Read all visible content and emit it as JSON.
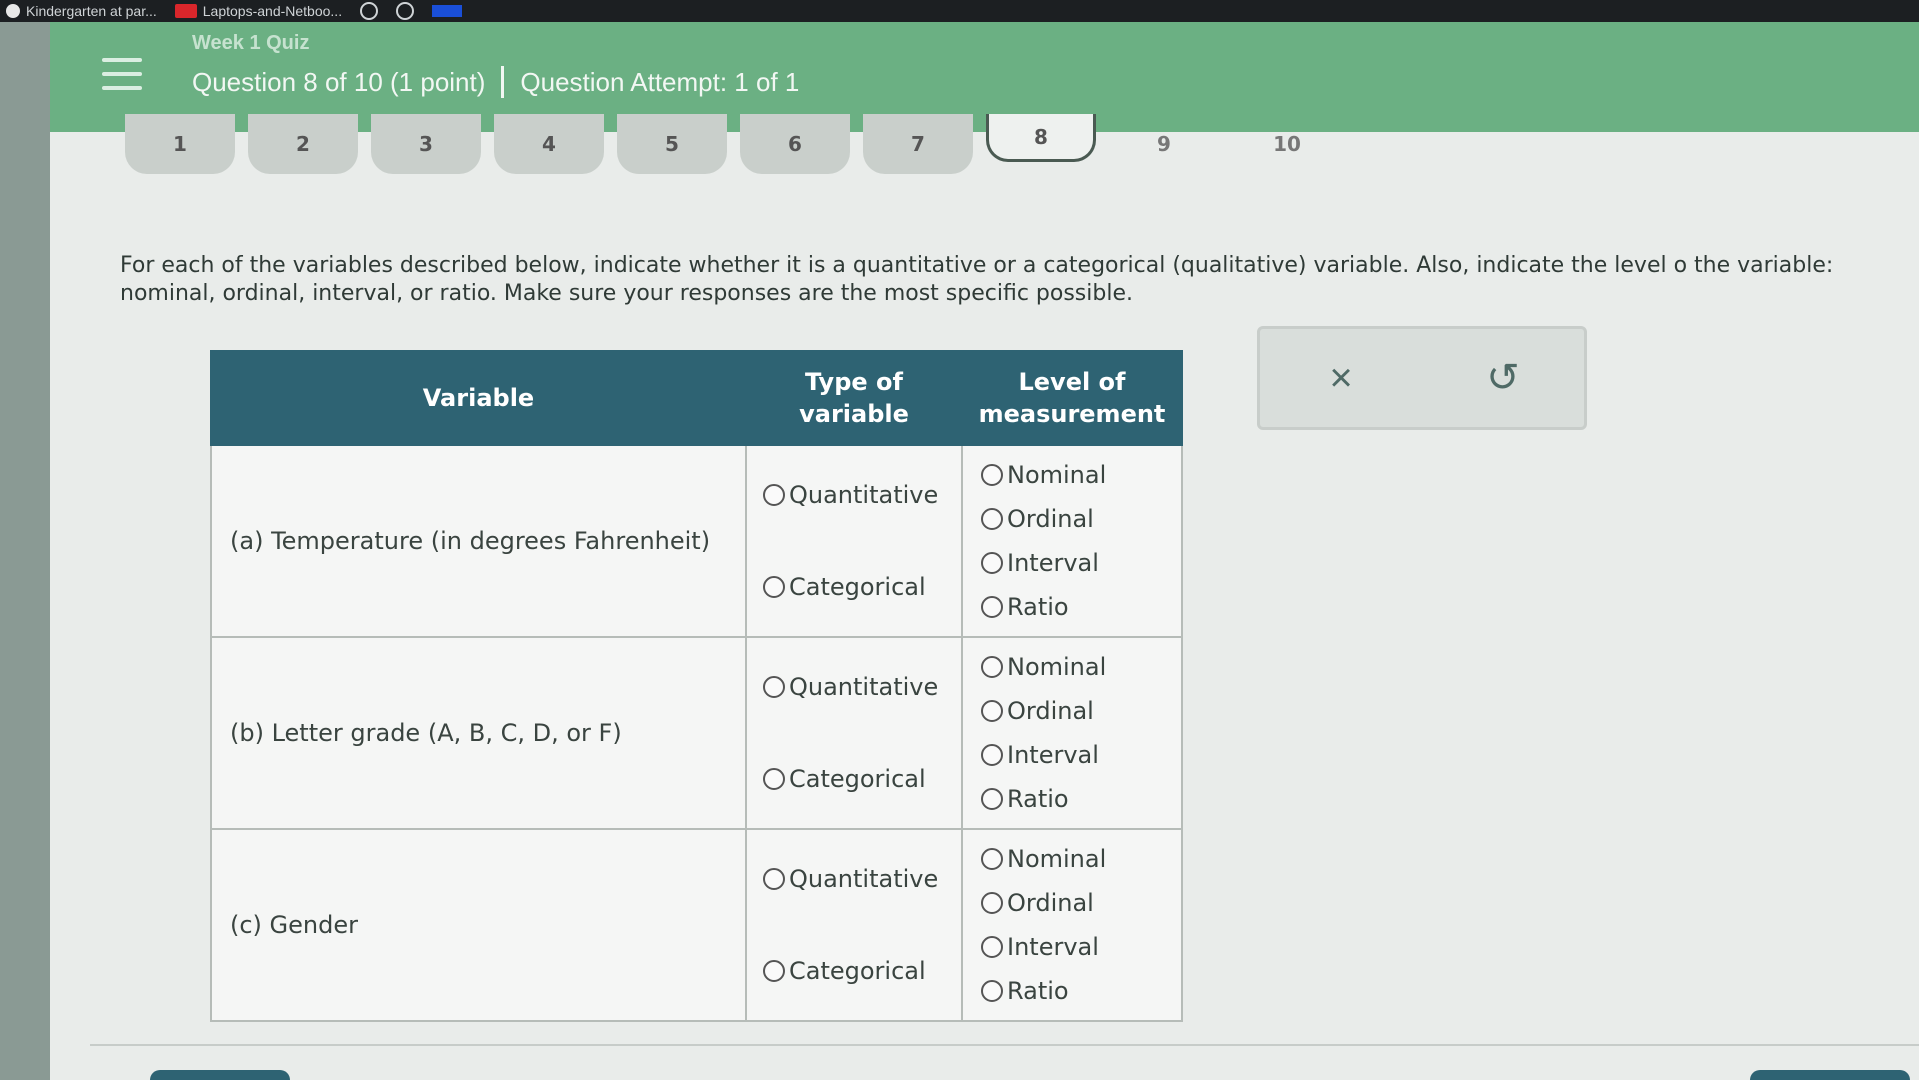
{
  "browser": {
    "bookmarks": [
      {
        "label": "Kindergarten at par...",
        "icon": "globe-icon"
      },
      {
        "label": "Laptops-and-Netboo...",
        "icon": "bookmark-icon"
      }
    ]
  },
  "header": {
    "quiz_title": "Week 1 Quiz",
    "question_label": "Question 8 of 10 (1 point)",
    "attempt_label": "Question Attempt: 1 of 1",
    "menu_icon": "hamburger-menu-icon",
    "colors": {
      "header": "#6bb083",
      "table_header": "#2e6373"
    }
  },
  "question_tabs": [
    "1",
    "2",
    "3",
    "4",
    "5",
    "6",
    "7",
    "8",
    "9",
    "10"
  ],
  "current_question": "8",
  "instructions": "For each of the variables described below, indicate whether it is a quantitative or a categorical (qualitative) variable. Also, indicate the level o the variable: nominal, ordinal, interval, or ratio. Make sure your responses are the most specific possible.",
  "table": {
    "headers": {
      "variable": "Variable",
      "type": "Type of variable",
      "level": "Level of measurement"
    },
    "rows": [
      {
        "variable": "(a) Temperature (in degrees Fahrenheit)",
        "type_options": [
          "Quantitative",
          "Categorical"
        ],
        "level_options": [
          "Nominal",
          "Ordinal",
          "Interval",
          "Ratio"
        ]
      },
      {
        "variable": "(b) Letter grade (A, B, C, D, or F)",
        "type_options": [
          "Quantitative",
          "Categorical"
        ],
        "level_options": [
          "Nominal",
          "Ordinal",
          "Interval",
          "Ratio"
        ]
      },
      {
        "variable": "(c) Gender",
        "type_options": [
          "Quantitative",
          "Categorical"
        ],
        "level_options": [
          "Nominal",
          "Ordinal",
          "Interval",
          "Ratio"
        ]
      }
    ]
  },
  "actions": {
    "clear_symbol": "×",
    "undo_symbol": "↺"
  }
}
